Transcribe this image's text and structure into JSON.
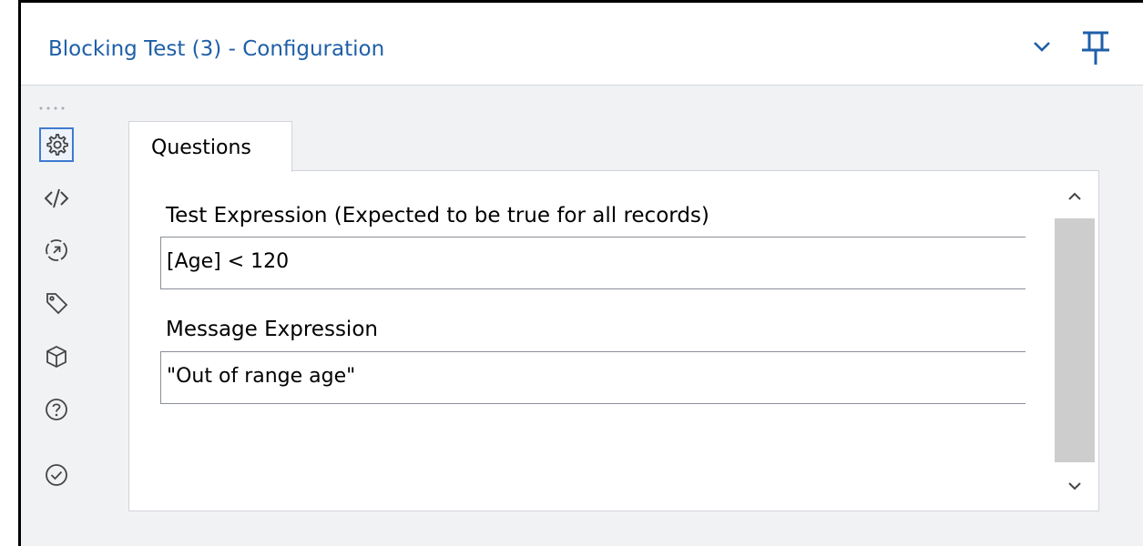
{
  "window": {
    "title": "Blocking Test (3) - Configuration"
  },
  "sidebar": {
    "items": [
      {
        "icon": "gear-icon",
        "active": true
      },
      {
        "icon": "code-icon",
        "active": false
      },
      {
        "icon": "navigate-arrow-icon",
        "active": false
      },
      {
        "icon": "tag-icon",
        "active": false
      },
      {
        "icon": "cube-icon",
        "active": false
      },
      {
        "icon": "help-icon",
        "active": false
      },
      {
        "icon": "check-circle-icon",
        "active": false
      }
    ]
  },
  "tabs": [
    {
      "label": "Questions"
    }
  ],
  "form": {
    "test_expression": {
      "label": "Test Expression (Expected to be true for all records)",
      "value": "[Age] < 120"
    },
    "message_expression": {
      "label": "Message Expression",
      "value": "\"Out of range age\""
    }
  },
  "colors": {
    "title": "#1f5fa8",
    "accent": "#3d7bd1",
    "panel_background": "#f1f2f4"
  }
}
